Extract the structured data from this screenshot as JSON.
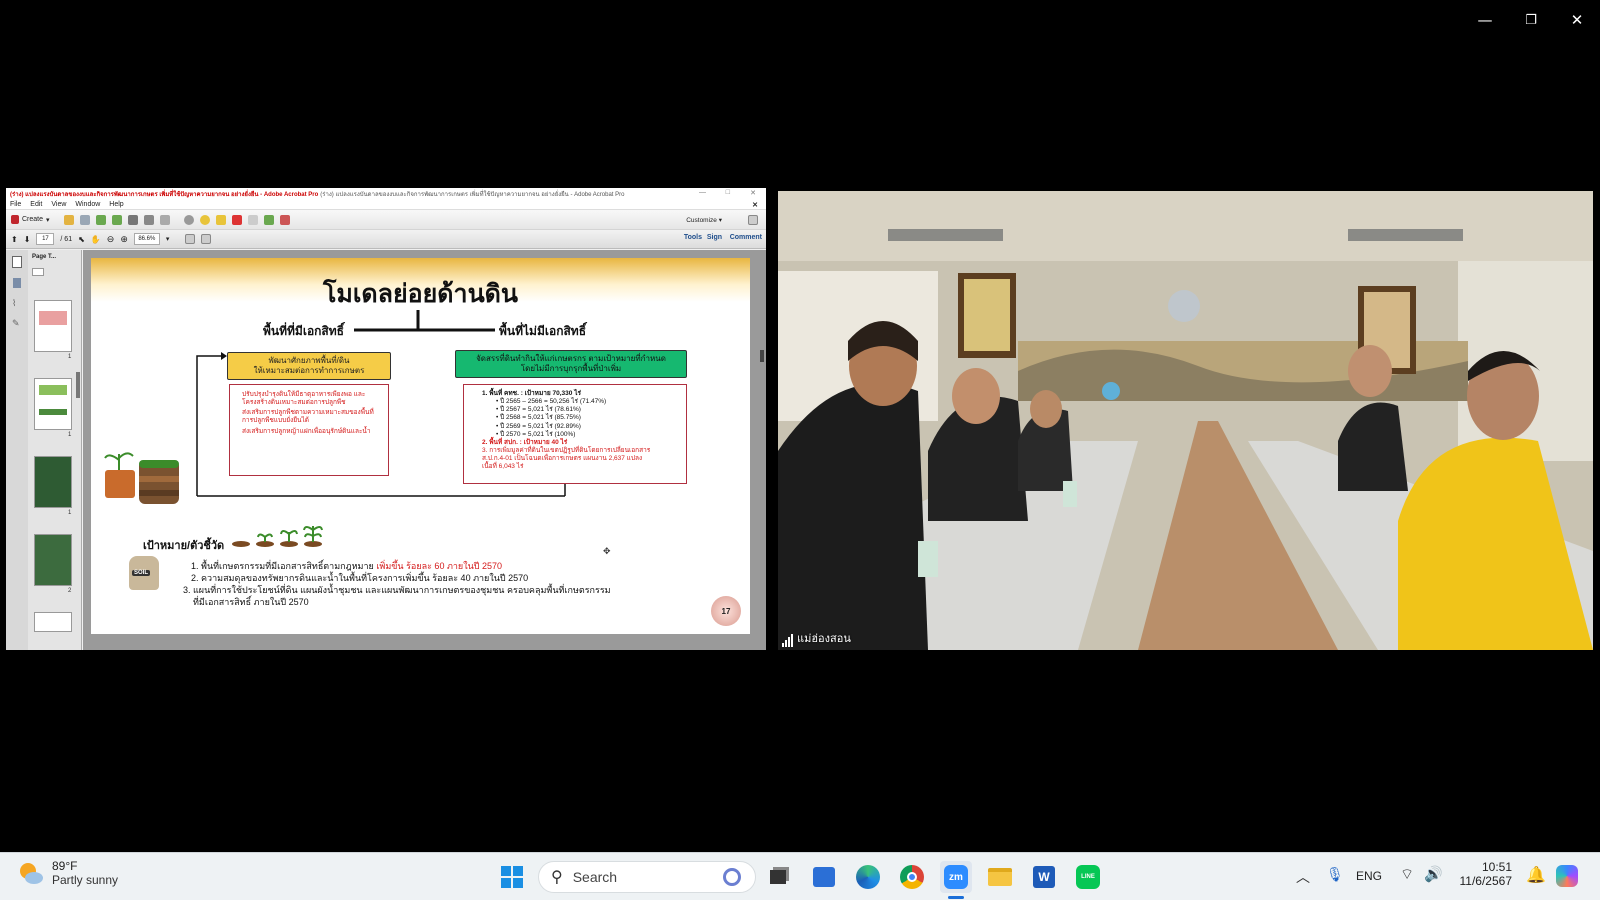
{
  "window_controls": {
    "minimize": "—",
    "restore": "❐",
    "close": "✕"
  },
  "acrobat": {
    "title": "(ร่าง) แปลงแรงบันดาลของงบและกิจการพัฒนาการเกษตร เพิ่มที่ใช้ปัญหาความยากจน อย่างยั่งยืน - Adobe Acrobat Pro",
    "menu": [
      "File",
      "Edit",
      "View",
      "Window",
      "Help"
    ],
    "create_label": "Create",
    "customize_label": "Customize",
    "page_current": "17",
    "page_total": "/ 61",
    "zoom": "86.6%",
    "tools_label": "Tools",
    "sign_label": "Sign",
    "comment_label": "Comment",
    "sidebar_title": "Page T...",
    "thumb_numbers": [
      "1",
      "1",
      "1",
      "2"
    ]
  },
  "slide": {
    "title": "โมเดลย่อยด้านดิน",
    "left_heading": "พื้นที่ที่มีเอกสิทธิ์",
    "right_heading": "พื้นที่ไม่มีเอกสิทธิ์",
    "yellow_box": [
      "พัฒนาศักยภาพพื้นที่/ดิน",
      "ให้เหมาะสมต่อการทำการเกษตร"
    ],
    "green_box": [
      "จัดสรรที่ดินทำกินให้แก่เกษตรกร ตามเป้าหมายที่กำหนด",
      "โดยไม่มีการบุกรุกพื้นที่ป่าเพิ่ม"
    ],
    "left_items": [
      "ปรับปรุงบำรุงดินให้มีธาตุอาหารเพียงพอ และโครงสร้างดินเหมาะสมต่อการปลูกพืช",
      "ส่งเสริมการปลูกพืชตามความเหมาะสมของพื้นที่ การปลูกพืชแบบยั่งยืนได้",
      "ส่งเสริมการปลูกหญ้าแฝกเพื่ออนุรักษ์ดินและน้ำ"
    ],
    "right_lines": [
      "1. พื้นที่ คทช. : เป้าหมาย 70,330 ไร่",
      "• ปี 2565 – 2566  =  50,256 ไร่ (71.47%)",
      "• ปี 2567            =  5,021   ไร่ (78.61%)",
      "• ปี 2568            =  5,021   ไร่ (85.75%)",
      "• ปี 2569            =  5,021   ไร่ (92.89%)",
      "• ปี 2570            =  5,021   ไร่ (100%)"
    ],
    "right_red_lines": [
      "2. พื้นที่ สปก. : เป้าหมาย 40 ไร่",
      "3. การเพิ่มมูลค่าที่ดินในเขตปฏิรูปที่ดินโดยการเปลี่ยนเอกสาร",
      "ส.ป.ก.4-01 เป็นโฉนดเพื่อการเกษตร แผนงาน 2,637 แปลง",
      "เนื้อที่ 6,043 ไร่"
    ],
    "goal_heading": "เป้าหมาย/ตัวชี้วัด",
    "goals": [
      {
        "text": "1.  พื้นที่เกษตรกรรมที่มีเอกสารสิทธิ์ตามกฎหมาย ",
        "highlight": "เพิ่มขึ้น ร้อยละ 60 ภายในปี 2570"
      },
      {
        "text": "2.  ความสมดุลของทรัพยากรดินและน้ำในพื้นที่โครงการเพิ่มขึ้น ร้อยละ 40 ภายในปี 2570",
        "highlight": ""
      },
      {
        "text": "3.  แผนที่การใช้ประโยชน์ที่ดิน แผนผังน้ำชุมชน และแผนพัฒนาการเกษตรของชุมชน ครอบคลุมพื้นที่เกษตรกรรม",
        "highlight": ""
      }
    ],
    "goal3_cont": "ที่มีเอกสารสิทธิ์ ภายในปี 2570",
    "soil_label": "SOIL",
    "page_badge": "17"
  },
  "video": {
    "participant_name": "แม่ฮ่องสอน"
  },
  "taskbar": {
    "weather_temp": "89°F",
    "weather_desc": "Partly sunny",
    "search_placeholder": "Search",
    "lang": "ENG",
    "time": "10:51",
    "date": "11/6/2567",
    "zoom_app": "zm",
    "line_app": "LINE"
  },
  "colors": {
    "accent_red": "#d41a1a",
    "slide_yellow": "#f5cc47",
    "slide_green": "#16b870",
    "taskbar_bg": "#eef2f4"
  }
}
